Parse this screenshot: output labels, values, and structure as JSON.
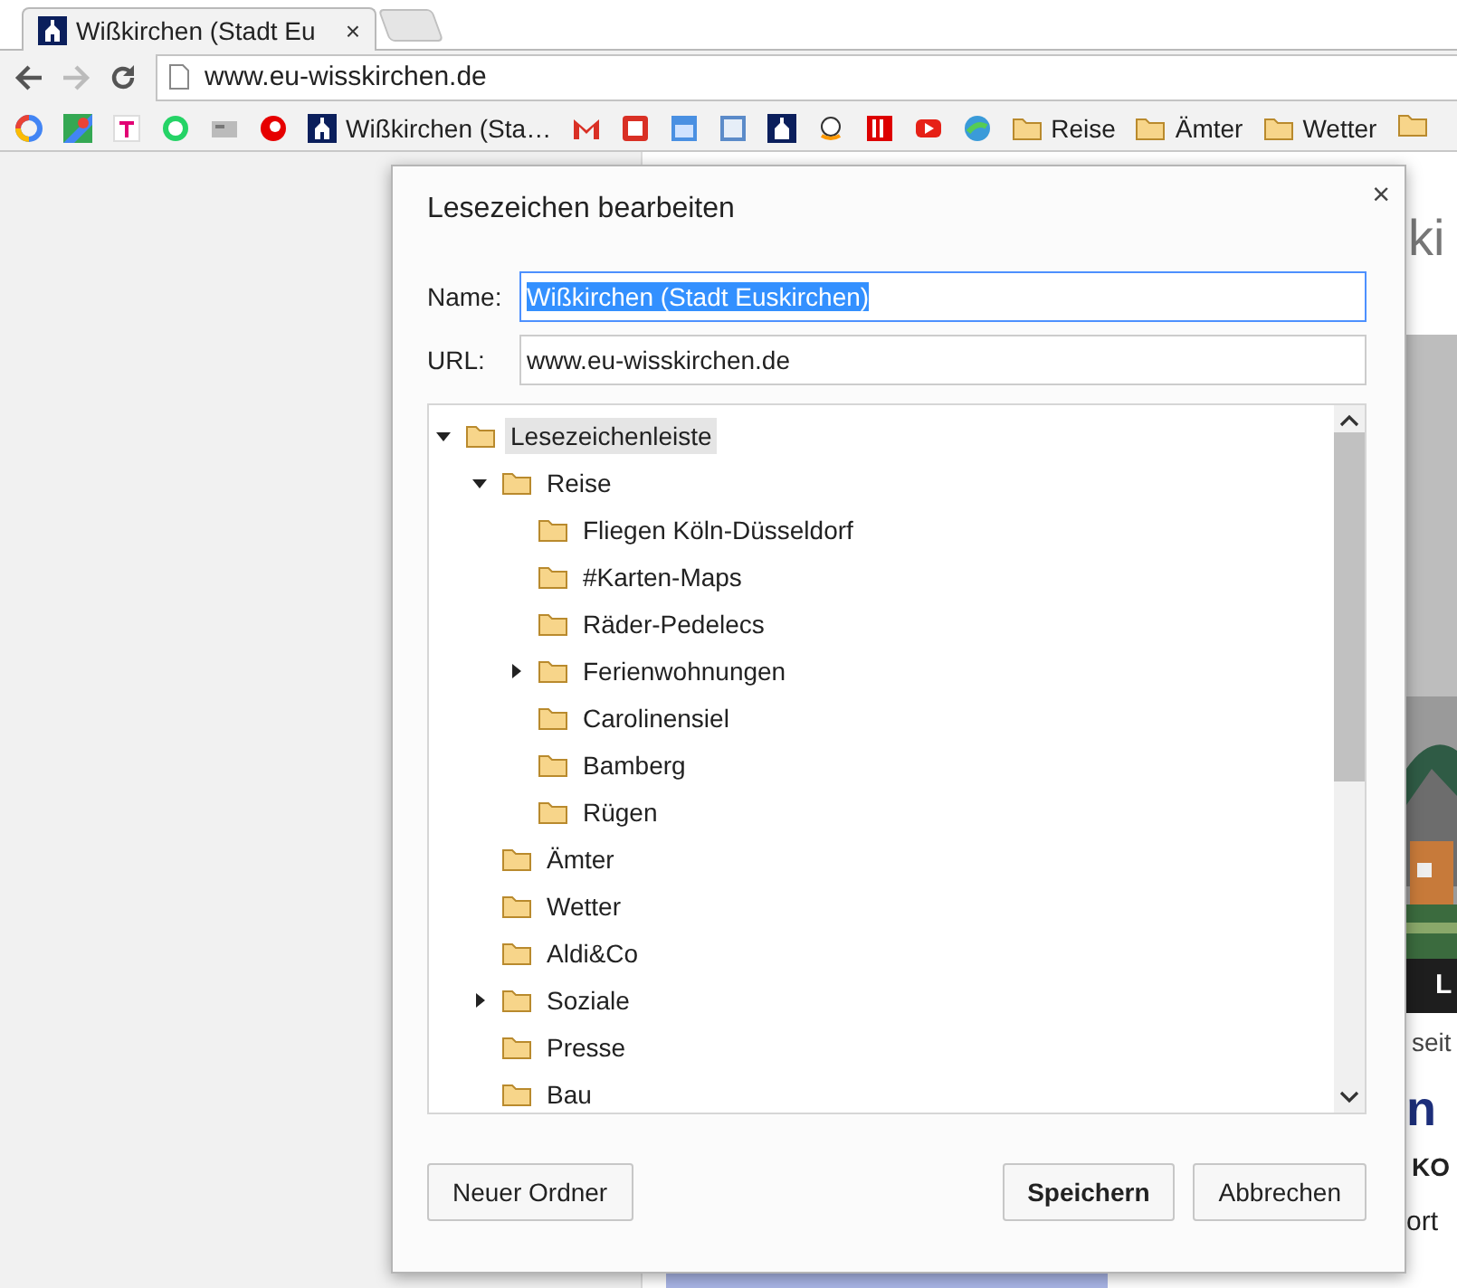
{
  "tab": {
    "title": "Wißkirchen (Stadt Eu",
    "close": "×",
    "selected": true
  },
  "toolbar": {
    "back_disabled": false,
    "forward_disabled": true,
    "address": "www.eu-wisskirchen.de"
  },
  "bookmarks": [
    {
      "kind": "site",
      "label": "Wißkirchen (Sta…"
    },
    {
      "kind": "folder",
      "label": "Reise"
    },
    {
      "kind": "folder",
      "label": "Ämter"
    },
    {
      "kind": "folder",
      "label": "Wetter"
    }
  ],
  "page": {
    "heading": "ki",
    "caption": "L",
    "link": "seit",
    "title": "n",
    "subtitle": "KO",
    "text": "ort"
  },
  "dialog": {
    "title": "Lesezeichen bearbeiten",
    "close": "×",
    "name_label": "Name:",
    "name_value": "Wißkirchen (Stadt Euskirchen)",
    "name_text_selected": true,
    "url_label": "URL:",
    "url_value": "www.eu-wisskirchen.de",
    "tree": [
      {
        "label": "Lesezeichenleiste",
        "selected": true,
        "expanded": true,
        "children": [
          {
            "label": "Reise",
            "selected": false,
            "expanded": true,
            "children": [
              {
                "label": "Fliegen Köln-Düsseldorf",
                "selected": false
              },
              {
                "label": "#Karten-Maps",
                "selected": false
              },
              {
                "label": "Räder-Pedelecs",
                "selected": false
              },
              {
                "label": "Ferienwohnungen",
                "selected": false,
                "expanded": false
              },
              {
                "label": "Carolinensiel",
                "selected": false
              },
              {
                "label": "Bamberg",
                "selected": false
              },
              {
                "label": "Rügen",
                "selected": false
              }
            ]
          },
          {
            "label": "Ämter",
            "selected": false
          },
          {
            "label": "Wetter",
            "selected": false
          },
          {
            "label": "Aldi&Co",
            "selected": false
          },
          {
            "label": "Soziale",
            "selected": false,
            "expanded": false
          },
          {
            "label": "Presse",
            "selected": false
          },
          {
            "label": "Bau",
            "selected": false
          }
        ]
      }
    ],
    "buttons": [
      {
        "kind": "left",
        "label": "Neuer Ordner",
        "default": false
      },
      {
        "kind": "right",
        "label": "Speichern",
        "default": true
      },
      {
        "kind": "right",
        "label": "Abbrechen",
        "default": false
      }
    ]
  }
}
